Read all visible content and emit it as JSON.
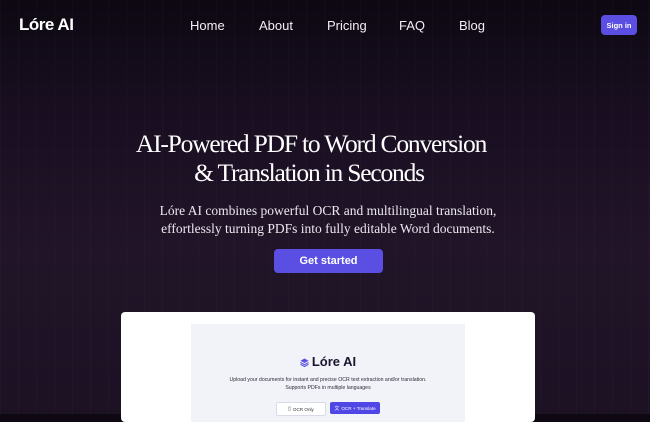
{
  "brand": {
    "name": "Lóre AI",
    "accent": "#5b4fe3"
  },
  "nav": {
    "links": [
      {
        "label": "Home"
      },
      {
        "label": "About"
      },
      {
        "label": "Pricing"
      },
      {
        "label": "FAQ"
      },
      {
        "label": "Blog"
      }
    ],
    "signin_label": "Sign in"
  },
  "hero": {
    "title_line1": "AI-Powered PDF to Word Conversion",
    "title_line2": "& Translation in Seconds",
    "subtitle_line1": "Lóre AI combines powerful OCR and multilingual translation,",
    "subtitle_line2": "effortlessly turning PDFs into fully editable Word documents.",
    "cta_label": "Get started"
  },
  "preview": {
    "app_name": "Lóre AI",
    "description_line1": "Upload your documents for instant and precise OCR text extraction and/or translation.",
    "description_line2": "Supports PDFs in multiple languages",
    "modes": [
      {
        "label": "OCR Only",
        "icon": "document-icon",
        "selected": false
      },
      {
        "label": "OCR + Translate",
        "icon": "translate-icon",
        "selected": true
      }
    ]
  }
}
